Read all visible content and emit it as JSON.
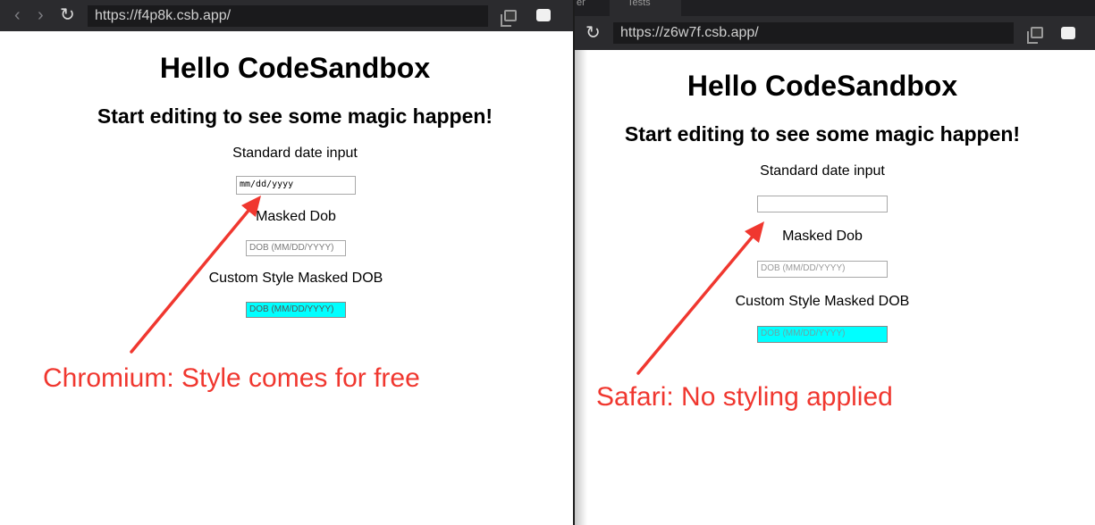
{
  "left_window": {
    "browser_label": "Chromium",
    "url": "https://f4p8k.csb.app/",
    "heading": "Hello CodeSandbox",
    "subheading": "Start editing to see some magic happen!",
    "standard_date_label": "Standard date input",
    "date_input_value": "mm/dd/yyyy",
    "masked_dob_label": "Masked Dob",
    "masked_dob_placeholder": "DOB (MM/DD/YYYY)",
    "custom_masked_label": "Custom Style Masked DOB",
    "custom_masked_placeholder": "DOB (MM/DD/YYYY)",
    "annotation": "Chromium: Style comes for free"
  },
  "right_window": {
    "tabs": [
      "er",
      "Tests"
    ],
    "url": "https://z6w7f.csb.app/",
    "heading": "Hello CodeSandbox",
    "subheading": "Start editing to see some magic happen!",
    "standard_date_label": "Standard date input",
    "date_input_value": "",
    "masked_dob_label": "Masked Dob",
    "masked_dob_placeholder": "DOB (MM/DD/YYYY)",
    "custom_masked_label": "Custom Style Masked DOB",
    "custom_masked_placeholder": "DOB (MM/DD/YYYY)",
    "annotation": "Safari: No styling applied"
  },
  "icons": {
    "back": "chevron-left-icon",
    "forward": "chevron-right-icon",
    "reload": "reload-icon",
    "copy": "copy-icon",
    "screen": "screen-icon"
  },
  "colors": {
    "annotation_red": "#f0372f",
    "custom_input_bg": "#00ffff",
    "toolbar_bg": "#2b2b2e",
    "url_bg": "#1a1a1c"
  }
}
